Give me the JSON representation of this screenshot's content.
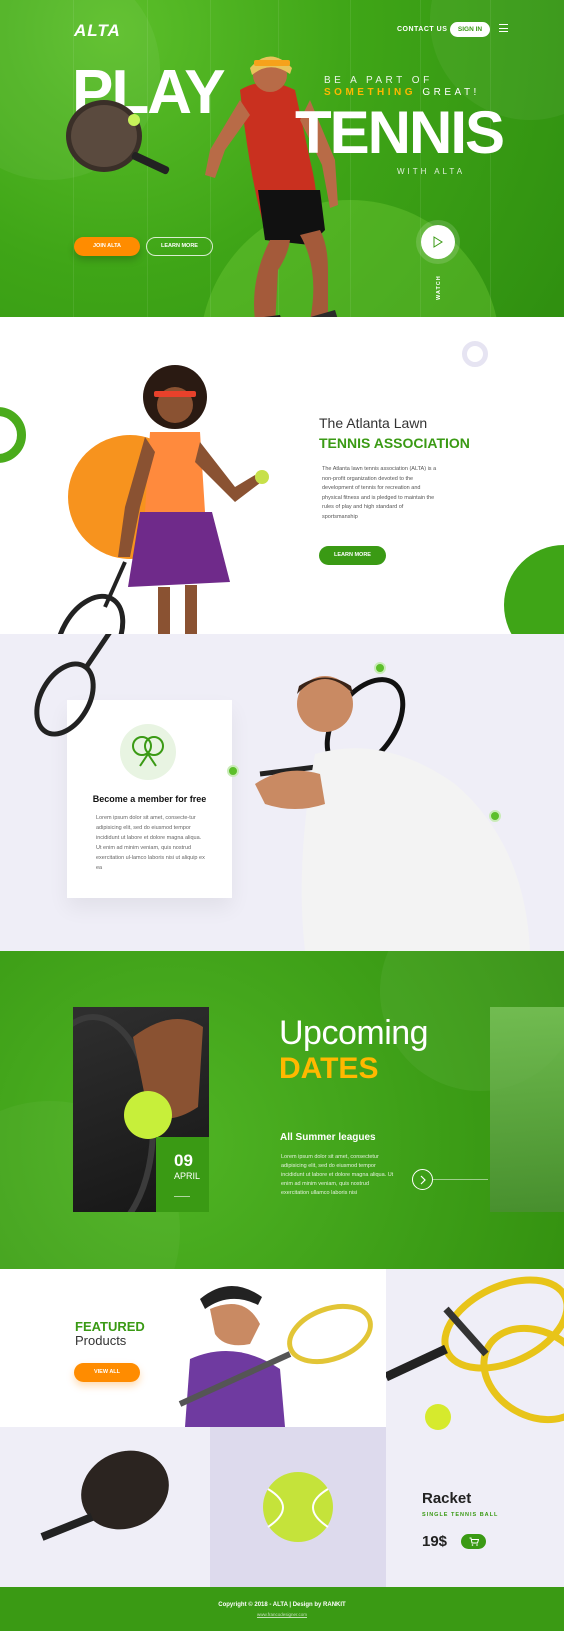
{
  "hero": {
    "logo": "ALTA",
    "nav": {
      "contact": "CONTACT US",
      "signin": "SIGN IN"
    },
    "headline_left": "PLAY",
    "headline_right": "TENNIS",
    "tagline_line1": "BE A PART OF",
    "tagline_highlight": "SOMETHING",
    "tagline_rest": " GREAT!",
    "tagline_line3": "WITH ALTA",
    "btn_join": "JOIN ALTA",
    "btn_learn": "LEARN MORE",
    "watch_label": "WATCH"
  },
  "assoc": {
    "title_light": "The Atlanta Lawn",
    "title_bold": "TENNIS ASSOCIATION",
    "body": "The Atlanta lawn tennis association (ALTA) is a non-profit organization devoted to the development of tennis for recreation and physical fitness and is pledged to maintain the rules of play and high standard of sportsmanship",
    "btn": "LEARN MORE"
  },
  "member": {
    "title": "Become a member for free",
    "body": "Lorem ipsum dolor sit amet, consecte-tur adipisicing elit, sed do eiusmod tempor incididunt ut labore et dolore magna aliqua. Ut enim ad minim veniam, quis nostrud exercitation ul-lamco laboris nisi ut aliquip ex ea"
  },
  "upcoming": {
    "title_light": "Upcoming",
    "title_bold": "DATES",
    "date_day": "09",
    "date_month": "APRIL",
    "subtitle": "All Summer leagues",
    "body": "Lorem ipsum dolor sit amet, consectetur adipisicing elit, sed do eiusmod tempor incididunt ut labore et dolore magna aliqua. Ut enim ad minim veniam, quis nostrud exercitation ullamco laboris nisi"
  },
  "products": {
    "featured_bold": "FEATURED",
    "featured_light": "Products",
    "btn_view": "VIEW ALL",
    "racket_name": "Racket",
    "racket_sub": "SINGLE TENNIS BALL",
    "racket_price": "19$"
  },
  "footer": {
    "copyright": "Copyright © 2018 - ALTA | Design by RANKIT",
    "link": "www.francodesigner.com"
  },
  "colors": {
    "brand_green": "#3a9a14",
    "accent_orange": "#ff8c00",
    "accent_yellow": "#ffb800",
    "lavender": "#efeef7"
  }
}
